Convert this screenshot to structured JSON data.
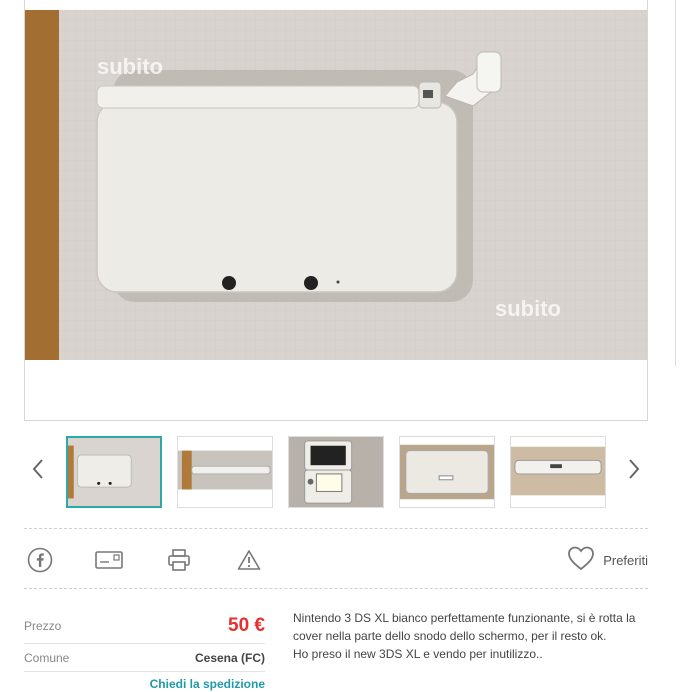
{
  "gallery": {
    "watermark": "subito",
    "nav_prev_icon": "chevron-left-icon",
    "nav_next_icon": "chevron-right-icon",
    "active_color": "#2fa8a8"
  },
  "actions": {
    "facebook_icon": "facebook-icon",
    "message_icon": "envelope-icon",
    "print_icon": "printer-icon",
    "report_icon": "warning-icon",
    "favorites_label": "Preferiti"
  },
  "details": {
    "price_label": "Prezzo",
    "price_value": "50 €",
    "city_label": "Comune",
    "city_value": "Cesena (FC)",
    "shipping_link": "Chiedi la spedizione",
    "price_color": "#e53030",
    "link_color": "#1e9aa8"
  },
  "description": {
    "lines": [
      "Nintendo 3 DS XL bianco perfettamente funzionante, si è rotta la",
      "cover nella parte dello snodo dello schermo, per il resto ok.",
      "Ho preso il new 3DS XL e vendo per inutilizzo.."
    ]
  }
}
